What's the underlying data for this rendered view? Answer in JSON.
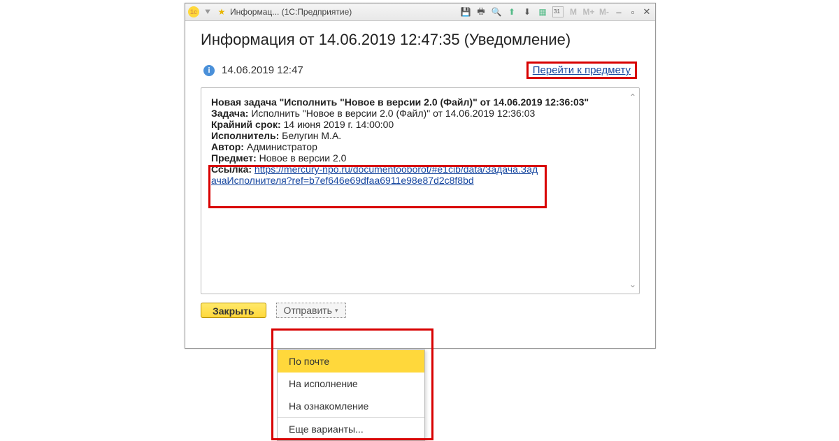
{
  "titlebar": {
    "title_short": "Информац...",
    "title_suffix": "(1С:Предприятие)",
    "m1": "M",
    "m2": "M+",
    "m3": "M-"
  },
  "page": {
    "title": "Информация от 14.06.2019 12:47:35 (Уведомление)",
    "timestamp": "14.06.2019 12:47",
    "goto_subject": "Перейти к предмету"
  },
  "body": {
    "line1_label": "Новая задача \"Исполнить \"Новое в версии 2.0 (Файл)\" от 14.06.2019 12:36:03\"",
    "task_label": "Задача:",
    "task_value": " Исполнить \"Новое в версии 2.0 (Файл)\" от 14.06.2019 12:36:03",
    "deadline_label": "Крайний срок:",
    "deadline_value": " 14 июня 2019 г. 14:00:00",
    "executor_label": "Исполнитель:",
    "executor_value": " Белугин М.А.",
    "author_label": "Автор:",
    "author_value": " Администратор",
    "subject_label": "Предмет:",
    "subject_value": " Новое в версии 2.0",
    "link_label": "Ссылка:",
    "link_url": "https://mercury-npo.ru/documentooborot/#e1cib/data/Задача.ЗадачаИсполнителя?ref=b7ef646e69dfaa6911e98e87d2c8f8bd"
  },
  "buttons": {
    "close": "Закрыть",
    "send": "Отправить"
  },
  "menu": {
    "by_mail": "По почте",
    "to_exec": "На исполнение",
    "to_review": "На ознакомление",
    "more": "Еще варианты..."
  }
}
